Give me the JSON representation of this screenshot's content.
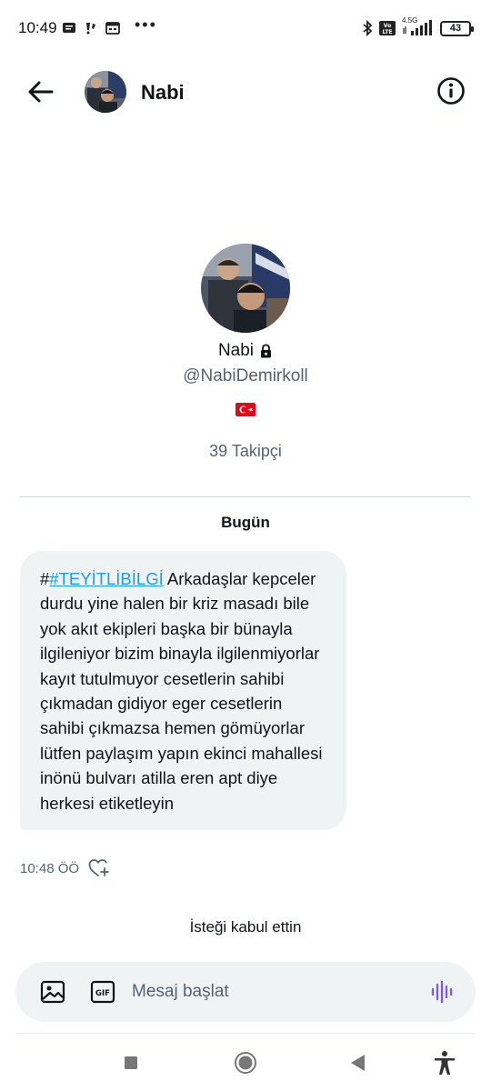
{
  "status_bar": {
    "time": "10:49",
    "dots": "•••",
    "network": "4.5G",
    "battery": "43"
  },
  "header": {
    "name": "Nabi"
  },
  "profile": {
    "name": "Nabi",
    "handle": "@NabiDemirkoll",
    "flag": "turkey-flag",
    "followers": "39 Takipçi"
  },
  "conversation": {
    "day_label": "Bugün",
    "message": {
      "hash_prefix": "#",
      "hashtag": "#TEYİTLİBİLGİ",
      "text": " Arkadaşlar kepceler durdu yine halen bir kriz masadı bile yok akıt ekipleri başka bir bünayla ilgileniyor bizim binayla ilgilenmiyorlar kayıt tutulmuyor cesetlerin sahibi çıkmadan gidiyor eger cesetlerin sahibi çıkmazsa hemen gömüyorlar lütfen paylaşım yapın ekinci mahallesi inönü bulvarı atilla eren apt diye herkesi etiketleyin",
      "time": "10:48 ÖÖ"
    },
    "accepted_note": "İsteği kabul ettin"
  },
  "composer": {
    "placeholder": "Mesaj başlat"
  },
  "colors": {
    "accent": "#1d9bf0",
    "voice": "#7856ff",
    "bubble": "#eff3f4",
    "secondary_text": "#536471"
  }
}
